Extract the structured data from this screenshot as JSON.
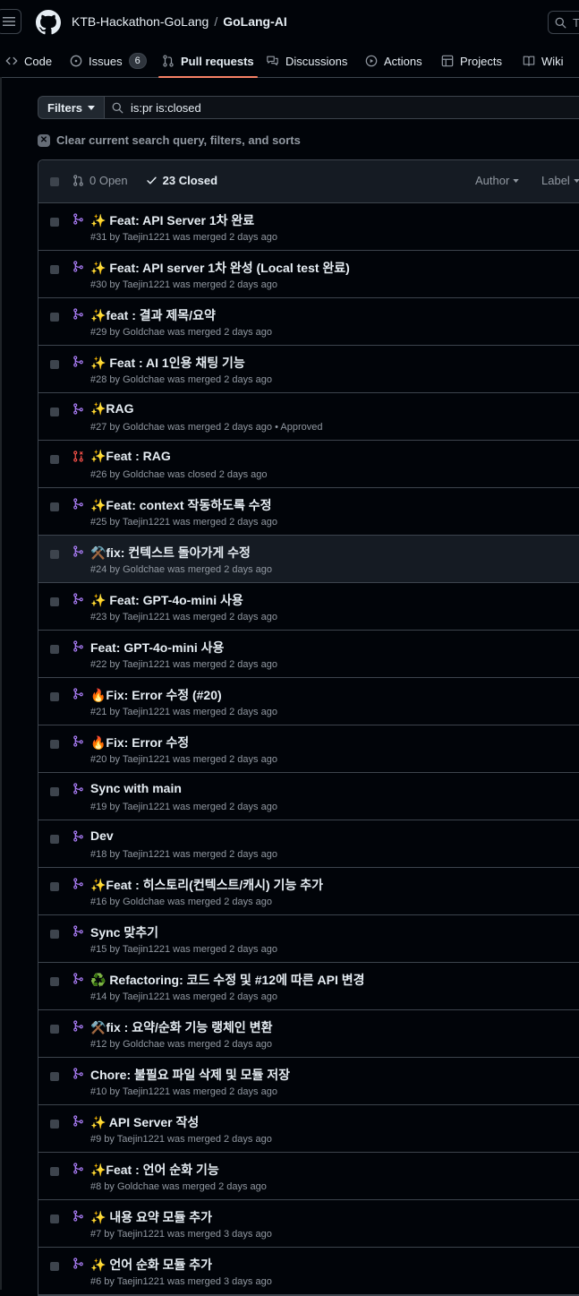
{
  "header": {
    "owner": "KTB-Hackathon-GoLang",
    "separator": "/",
    "repo": "GoLang-AI",
    "search_hint": "T"
  },
  "nav": {
    "code": "Code",
    "issues": "Issues",
    "issues_count": "6",
    "pull_requests": "Pull requests",
    "discussions": "Discussions",
    "actions": "Actions",
    "projects": "Projects",
    "wiki": "Wiki"
  },
  "filters": {
    "button": "Filters",
    "query": "is:pr is:closed",
    "clear": "Clear current search query, filters, and sorts"
  },
  "list_header": {
    "open": "0 Open",
    "closed": "23 Closed",
    "author": "Author",
    "label": "Label"
  },
  "colors": {
    "merged": "#ab7df8",
    "closed": "#f85149",
    "background": "#010409",
    "accent": "#f78166"
  },
  "prs": [
    {
      "state": "merged",
      "title": "✨ Feat: API Server 1차 완료",
      "meta": "#31 by Taejin1221 was merged 2 days ago"
    },
    {
      "state": "merged",
      "title": "✨ Feat: API server 1차 완성 (Local test 완료)",
      "meta": "#30 by Taejin1221 was merged 2 days ago"
    },
    {
      "state": "merged",
      "title": "✨feat : 결과 제목/요약",
      "meta": "#29 by Goldchae was merged 2 days ago"
    },
    {
      "state": "merged",
      "title": "✨ Feat : AI 1인용 채팅 기능",
      "meta": "#28 by Goldchae was merged 2 days ago"
    },
    {
      "state": "merged",
      "title": "✨RAG",
      "meta": "#27 by Goldchae was merged 2 days ago • Approved"
    },
    {
      "state": "closed",
      "title": "✨Feat : RAG",
      "meta": "#26 by Goldchae was closed 2 days ago"
    },
    {
      "state": "merged",
      "title": "✨Feat: context 작동하도록 수정",
      "meta": "#25 by Taejin1221 was merged 2 days ago"
    },
    {
      "state": "merged",
      "title": "⚒️fix: 컨텍스트 돌아가게 수정",
      "meta": "#24 by Goldchae was merged 2 days ago"
    },
    {
      "state": "merged",
      "title": "✨ Feat: GPT-4o-mini 사용",
      "meta": "#23 by Taejin1221 was merged 2 days ago"
    },
    {
      "state": "merged",
      "title": "Feat: GPT-4o-mini 사용",
      "meta": "#22 by Taejin1221 was merged 2 days ago"
    },
    {
      "state": "merged",
      "title": "🔥Fix: Error 수정 (#20)",
      "meta": "#21 by Taejin1221 was merged 2 days ago"
    },
    {
      "state": "merged",
      "title": "🔥Fix: Error 수정",
      "meta": "#20 by Taejin1221 was merged 2 days ago"
    },
    {
      "state": "merged",
      "title": "Sync with main",
      "meta": "#19 by Taejin1221 was merged 2 days ago"
    },
    {
      "state": "merged",
      "title": "Dev",
      "meta": "#18 by Taejin1221 was merged 2 days ago"
    },
    {
      "state": "merged",
      "title": "✨Feat : 히스토리(컨텍스트/캐시) 기능 추가",
      "meta": "#16 by Goldchae was merged 2 days ago"
    },
    {
      "state": "merged",
      "title": "Sync 맞추기",
      "meta": "#15 by Taejin1221 was merged 2 days ago"
    },
    {
      "state": "merged",
      "title": "♻️ Refactoring: 코드 수정 및 #12에 따른 API 변경",
      "meta": "#14 by Taejin1221 was merged 2 days ago"
    },
    {
      "state": "merged",
      "title": "⚒️fix : 요약/순화 기능 랭체인 변환",
      "meta": "#12 by Goldchae was merged 2 days ago"
    },
    {
      "state": "merged",
      "title": "Chore: 불필요 파일 삭제 및 모듈 저장",
      "meta": "#10 by Taejin1221 was merged 2 days ago"
    },
    {
      "state": "merged",
      "title": "✨ API Server 작성",
      "meta": "#9 by Taejin1221 was merged 2 days ago"
    },
    {
      "state": "merged",
      "title": "✨Feat : 언어 순화 기능",
      "meta": "#8 by Goldchae was merged 2 days ago"
    },
    {
      "state": "merged",
      "title": "✨ 내용 요약 모듈 추가",
      "meta": "#7 by Taejin1221 was merged 3 days ago"
    },
    {
      "state": "merged",
      "title": "✨ 언어 순화 모듈 추가",
      "meta": "#6 by Taejin1221 was merged 3 days ago"
    }
  ]
}
